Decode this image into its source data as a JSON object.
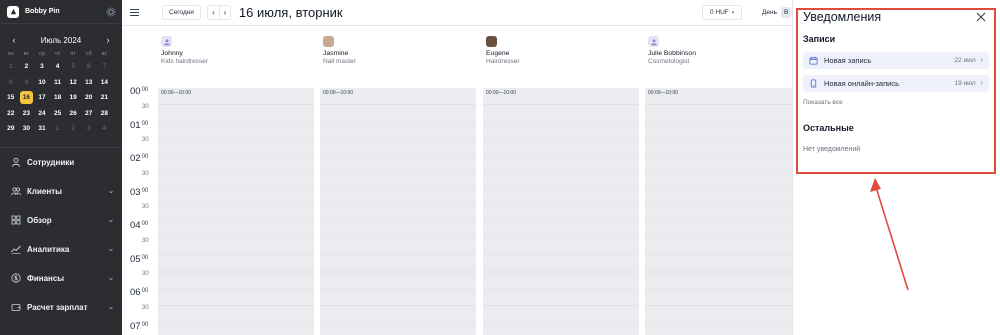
{
  "brand": {
    "name": "Bobby Pin"
  },
  "calendar": {
    "month": "Июль 2024",
    "weekdays": [
      "пн",
      "вт",
      "ср",
      "чт",
      "пт",
      "сб",
      "вс"
    ],
    "days": [
      {
        "d": "1",
        "dim": true
      },
      {
        "d": "2",
        "dim": false
      },
      {
        "d": "3",
        "dim": false
      },
      {
        "d": "4",
        "dim": false
      },
      {
        "d": "5",
        "dim": true
      },
      {
        "d": "6",
        "dim": true
      },
      {
        "d": "7",
        "dim": true
      },
      {
        "d": "8",
        "dim": true
      },
      {
        "d": "9",
        "dim": true
      },
      {
        "d": "10",
        "dim": false
      },
      {
        "d": "11",
        "dim": false
      },
      {
        "d": "12",
        "dim": false
      },
      {
        "d": "13",
        "dim": false
      },
      {
        "d": "14",
        "dim": false
      },
      {
        "d": "15",
        "dim": false
      },
      {
        "d": "16",
        "dim": false,
        "sel": true
      },
      {
        "d": "17",
        "dim": false
      },
      {
        "d": "18",
        "dim": false
      },
      {
        "d": "19",
        "dim": false
      },
      {
        "d": "20",
        "dim": false
      },
      {
        "d": "21",
        "dim": false
      },
      {
        "d": "22",
        "dim": false
      },
      {
        "d": "23",
        "dim": false
      },
      {
        "d": "24",
        "dim": false
      },
      {
        "d": "25",
        "dim": false
      },
      {
        "d": "26",
        "dim": false
      },
      {
        "d": "27",
        "dim": false
      },
      {
        "d": "28",
        "dim": false
      },
      {
        "d": "29",
        "dim": false
      },
      {
        "d": "30",
        "dim": false
      },
      {
        "d": "31",
        "dim": false
      },
      {
        "d": "1",
        "dim": true
      },
      {
        "d": "2",
        "dim": true
      },
      {
        "d": "3",
        "dim": true
      },
      {
        "d": "4",
        "dim": true
      }
    ],
    "accent": "#f5c542"
  },
  "nav": [
    {
      "label": "Сотрудники",
      "icon": "user-icon",
      "chev": false
    },
    {
      "label": "Клиенты",
      "icon": "users-icon",
      "chev": true
    },
    {
      "label": "Обзор",
      "icon": "grid-icon",
      "chev": true
    },
    {
      "label": "Аналитика",
      "icon": "chart-icon",
      "chev": true
    },
    {
      "label": "Финансы",
      "icon": "dollar-icon",
      "chev": true
    },
    {
      "label": "Расчет зарплат",
      "icon": "wallet-icon",
      "chev": true
    }
  ],
  "toolbar": {
    "today": "Сегодня",
    "prev": "‹",
    "next": "›",
    "date": "16 июля, вторник",
    "currency": "0 HUF",
    "view_label": "День",
    "view_extra": "В"
  },
  "staff": [
    {
      "name": "Johnny",
      "role": "Kids hairdresser",
      "avatar": "placeholder"
    },
    {
      "name": "Jasmine",
      "role": "Nail master",
      "avatar": "photo"
    },
    {
      "name": "Eugene",
      "role": "Hairdresser",
      "avatar": "photo2"
    },
    {
      "name": "Julie Bobbinson",
      "role": "Cosmetologist",
      "avatar": "placeholder"
    }
  ],
  "timeline": [
    {
      "h": "00",
      "m": "00"
    },
    {
      "h": "",
      "m": "30"
    },
    {
      "h": "01",
      "m": "00"
    },
    {
      "h": "",
      "m": "30"
    },
    {
      "h": "02",
      "m": "00"
    },
    {
      "h": "",
      "m": "30"
    },
    {
      "h": "03",
      "m": "00"
    },
    {
      "h": "",
      "m": "30"
    },
    {
      "h": "04",
      "m": "00"
    },
    {
      "h": "",
      "m": "30"
    },
    {
      "h": "05",
      "m": "00"
    },
    {
      "h": "",
      "m": "30"
    },
    {
      "h": "06",
      "m": "00"
    },
    {
      "h": "",
      "m": "30"
    },
    {
      "h": "07",
      "m": "00"
    }
  ],
  "slot_label": "00:00—10:00",
  "notifications": {
    "title": "Уведомления",
    "section_records": "Записи",
    "items": [
      {
        "label": "Новая запись",
        "date": "22 июл",
        "icon": "calendar-icon"
      },
      {
        "label": "Новая онлайн-запись",
        "date": "19 июл",
        "icon": "phone-icon"
      }
    ],
    "show_all": "Показать все",
    "section_other": "Остальные",
    "empty": "Нет уведомлений",
    "highlight_color": "#e04b3c"
  }
}
